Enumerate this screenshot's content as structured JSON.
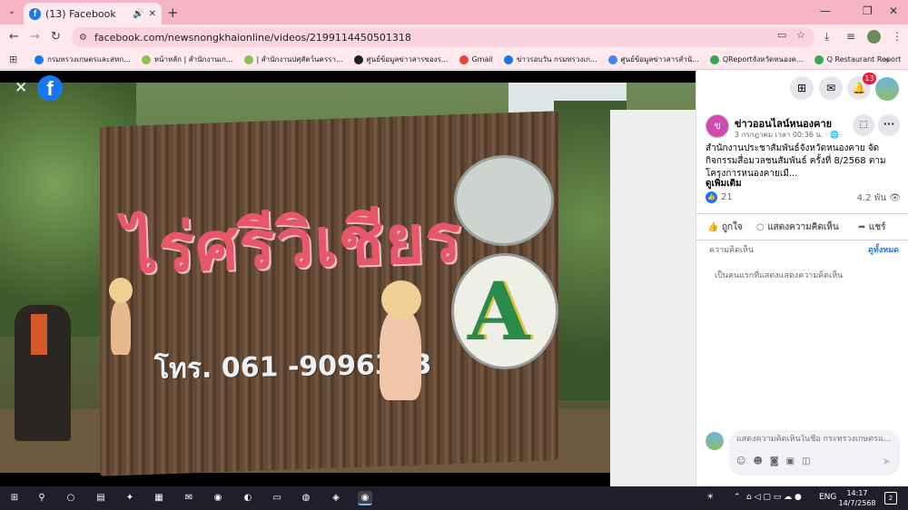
{
  "browser": {
    "tab": {
      "title": "(13) Facebook",
      "favicon": "facebook-icon"
    },
    "url": "facebook.com/newsnongkhaionline/videos/2199114450501318",
    "bookmarks": [
      {
        "label": "กรมทรวงเกษตรและสหก...",
        "color": "#1877f2"
      },
      {
        "label": "หน้าหลัก | สำนักงานเก...",
        "color": "#8bc34a"
      },
      {
        "label": "| สำนักงานปศุสัตว์นครรา...",
        "color": "#8bc34a"
      },
      {
        "label": "ศูนย์ข้อมูลข่าวสารของร...",
        "color": "#202124"
      },
      {
        "label": "Gmail",
        "color": "#ea4335"
      },
      {
        "label": "ข่าวรอบวัน กรมทรวงเก...",
        "color": "#1a73e8"
      },
      {
        "label": "ศูนย์ข้อมูลข่าวสารสำนั...",
        "color": "#4285f4"
      },
      {
        "label": "QReportจังหวัดหนองค...",
        "color": "#34a853"
      },
      {
        "label": "Q Restaurant Report",
        "color": "#34a853"
      }
    ]
  },
  "video": {
    "sign_text": "ไร่ศรีวิเชียร",
    "sign_phone": "โทร. 061 -9096373"
  },
  "panel": {
    "notifications_count": "13",
    "page_name": "ข่าวออนไลน์หนองคาย",
    "post_time": "3 กรกฎาคม เวลา 00:36 น. · 🌐",
    "post_text": "สำนักงานประชาสัมพันธ์จังหวัดหนองคาย จัดกิจกรรมสื่อมวลชนสัมพันธ์ ครั้งที่ 8/2568 ตามโครงการหนองคายเมื...",
    "see_more": "ดูเพิ่มเติม",
    "like_count": "21",
    "views": "4.2 พัน 👁",
    "actions": {
      "like": "ถูกใจ",
      "comment": "แสดงความคิดเห็น",
      "share": "แชร์"
    },
    "comments_label": "ความคิดเห็น",
    "all_comments": "ดูทั้งหมด",
    "first_comment": "เป็นคนแรกที่แสดงแสดงความคิดเห็น",
    "comment_placeholder": "แสดงความคิดเห็นในชื่อ กระทรวงเกษตรแ..."
  },
  "taskbar": {
    "language": "ENG",
    "time": "14:17",
    "date": "14/7/2568",
    "notifications": "2"
  }
}
